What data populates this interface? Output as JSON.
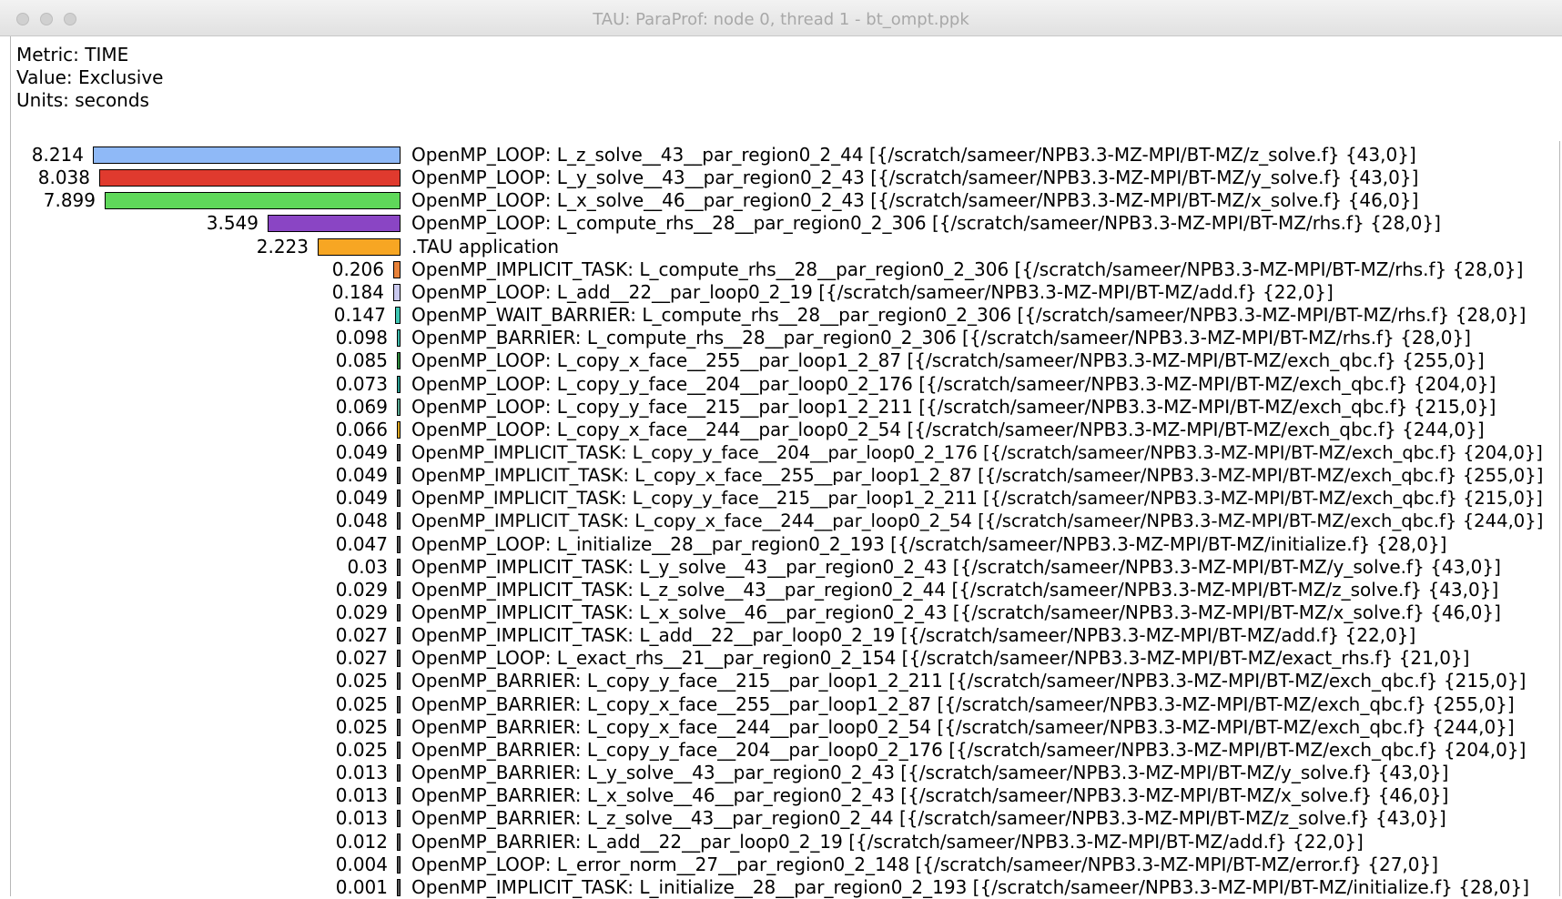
{
  "window": {
    "title": "TAU: ParaProf: node 0, thread 1 - bt_ompt.ppk"
  },
  "header": {
    "metric": "Metric: TIME",
    "value": "Value: Exclusive",
    "units": "Units: seconds"
  },
  "bar_max_value": 8.214,
  "rows": [
    {
      "value": "8.214",
      "color": "#8fb9f7",
      "name": "OpenMP_LOOP: L_z_solve__43__par_region0_2_44 [{/scratch/sameer/NPB3.3-MZ-MPI/BT-MZ/z_solve.f} {43,0}]"
    },
    {
      "value": "8.038",
      "color": "#e03a2e",
      "name": "OpenMP_LOOP: L_y_solve__43__par_region0_2_43 [{/scratch/sameer/NPB3.3-MZ-MPI/BT-MZ/y_solve.f} {43,0}]"
    },
    {
      "value": "7.899",
      "color": "#5fd85a",
      "name": "OpenMP_LOOP: L_x_solve__46__par_region0_2_43 [{/scratch/sameer/NPB3.3-MZ-MPI/BT-MZ/x_solve.f} {46,0}]"
    },
    {
      "value": "3.549",
      "color": "#8a45c4",
      "name": "OpenMP_LOOP: L_compute_rhs__28__par_region0_2_306 [{/scratch/sameer/NPB3.3-MZ-MPI/BT-MZ/rhs.f} {28,0}]"
    },
    {
      "value": "2.223",
      "color": "#f7a623",
      "name": ".TAU application"
    },
    {
      "value": "0.206",
      "color": "#e8823a",
      "name": "OpenMP_IMPLICIT_TASK: L_compute_rhs__28__par_region0_2_306 [{/scratch/sameer/NPB3.3-MZ-MPI/BT-MZ/rhs.f} {28,0}]"
    },
    {
      "value": "0.184",
      "color": "#c9c8ee",
      "name": "OpenMP_LOOP: L_add__22__par_loop0_2_19 [{/scratch/sameer/NPB3.3-MZ-MPI/BT-MZ/add.f} {22,0}]"
    },
    {
      "value": "0.147",
      "color": "#3fc7b3",
      "name": "OpenMP_WAIT_BARRIER: L_compute_rhs__28__par_region0_2_306 [{/scratch/sameer/NPB3.3-MZ-MPI/BT-MZ/rhs.f} {28,0}]"
    },
    {
      "value": "0.098",
      "color": "#3db8a8",
      "name": "OpenMP_BARRIER: L_compute_rhs__28__par_region0_2_306 [{/scratch/sameer/NPB3.3-MZ-MPI/BT-MZ/rhs.f} {28,0}]"
    },
    {
      "value": "0.085",
      "color": "#2e8b3d",
      "name": "OpenMP_LOOP: L_copy_x_face__255__par_loop1_2_87 [{/scratch/sameer/NPB3.3-MZ-MPI/BT-MZ/exch_qbc.f} {255,0}]"
    },
    {
      "value": "0.073",
      "color": "#2a9d8f",
      "name": "OpenMP_LOOP: L_copy_y_face__204__par_loop0_2_176 [{/scratch/sameer/NPB3.3-MZ-MPI/BT-MZ/exch_qbc.f} {204,0}]"
    },
    {
      "value": "0.069",
      "color": "#58a890",
      "name": "OpenMP_LOOP: L_copy_y_face__215__par_loop1_2_211 [{/scratch/sameer/NPB3.3-MZ-MPI/BT-MZ/exch_qbc.f} {215,0}]"
    },
    {
      "value": "0.066",
      "color": "#d9a420",
      "name": "OpenMP_LOOP: L_copy_x_face__244__par_loop0_2_54 [{/scratch/sameer/NPB3.3-MZ-MPI/BT-MZ/exch_qbc.f} {244,0}]"
    },
    {
      "value": "0.049",
      "color": "#555555",
      "name": "OpenMP_IMPLICIT_TASK: L_copy_y_face__204__par_loop0_2_176 [{/scratch/sameer/NPB3.3-MZ-MPI/BT-MZ/exch_qbc.f} {204,0}]"
    },
    {
      "value": "0.049",
      "color": "#555555",
      "name": "OpenMP_IMPLICIT_TASK: L_copy_x_face__255__par_loop1_2_87 [{/scratch/sameer/NPB3.3-MZ-MPI/BT-MZ/exch_qbc.f} {255,0}]"
    },
    {
      "value": "0.049",
      "color": "#555555",
      "name": "OpenMP_IMPLICIT_TASK: L_copy_y_face__215__par_loop1_2_211 [{/scratch/sameer/NPB3.3-MZ-MPI/BT-MZ/exch_qbc.f} {215,0}]"
    },
    {
      "value": "0.048",
      "color": "#555555",
      "name": "OpenMP_IMPLICIT_TASK: L_copy_x_face__244__par_loop0_2_54 [{/scratch/sameer/NPB3.3-MZ-MPI/BT-MZ/exch_qbc.f} {244,0}]"
    },
    {
      "value": "0.047",
      "color": "#555555",
      "name": "OpenMP_LOOP: L_initialize__28__par_region0_2_193 [{/scratch/sameer/NPB3.3-MZ-MPI/BT-MZ/initialize.f} {28,0}]"
    },
    {
      "value": "0.03",
      "color": "#555555",
      "name": "OpenMP_IMPLICIT_TASK: L_y_solve__43__par_region0_2_43 [{/scratch/sameer/NPB3.3-MZ-MPI/BT-MZ/y_solve.f} {43,0}]"
    },
    {
      "value": "0.029",
      "color": "#555555",
      "name": "OpenMP_IMPLICIT_TASK: L_z_solve__43__par_region0_2_44 [{/scratch/sameer/NPB3.3-MZ-MPI/BT-MZ/z_solve.f} {43,0}]"
    },
    {
      "value": "0.029",
      "color": "#555555",
      "name": "OpenMP_IMPLICIT_TASK: L_x_solve__46__par_region0_2_43 [{/scratch/sameer/NPB3.3-MZ-MPI/BT-MZ/x_solve.f} {46,0}]"
    },
    {
      "value": "0.027",
      "color": "#555555",
      "name": "OpenMP_IMPLICIT_TASK: L_add__22__par_loop0_2_19 [{/scratch/sameer/NPB3.3-MZ-MPI/BT-MZ/add.f} {22,0}]"
    },
    {
      "value": "0.027",
      "color": "#555555",
      "name": "OpenMP_LOOP: L_exact_rhs__21__par_region0_2_154 [{/scratch/sameer/NPB3.3-MZ-MPI/BT-MZ/exact_rhs.f} {21,0}]"
    },
    {
      "value": "0.025",
      "color": "#555555",
      "name": "OpenMP_BARRIER: L_copy_y_face__215__par_loop1_2_211 [{/scratch/sameer/NPB3.3-MZ-MPI/BT-MZ/exch_qbc.f} {215,0}]"
    },
    {
      "value": "0.025",
      "color": "#555555",
      "name": "OpenMP_BARRIER: L_copy_x_face__255__par_loop1_2_87 [{/scratch/sameer/NPB3.3-MZ-MPI/BT-MZ/exch_qbc.f} {255,0}]"
    },
    {
      "value": "0.025",
      "color": "#555555",
      "name": "OpenMP_BARRIER: L_copy_x_face__244__par_loop0_2_54 [{/scratch/sameer/NPB3.3-MZ-MPI/BT-MZ/exch_qbc.f} {244,0}]"
    },
    {
      "value": "0.025",
      "color": "#555555",
      "name": "OpenMP_BARRIER: L_copy_y_face__204__par_loop0_2_176 [{/scratch/sameer/NPB3.3-MZ-MPI/BT-MZ/exch_qbc.f} {204,0}]"
    },
    {
      "value": "0.013",
      "color": "#555555",
      "name": "OpenMP_BARRIER: L_y_solve__43__par_region0_2_43 [{/scratch/sameer/NPB3.3-MZ-MPI/BT-MZ/y_solve.f} {43,0}]"
    },
    {
      "value": "0.013",
      "color": "#555555",
      "name": "OpenMP_BARRIER: L_x_solve__46__par_region0_2_43 [{/scratch/sameer/NPB3.3-MZ-MPI/BT-MZ/x_solve.f} {46,0}]"
    },
    {
      "value": "0.013",
      "color": "#555555",
      "name": "OpenMP_BARRIER: L_z_solve__43__par_region0_2_44 [{/scratch/sameer/NPB3.3-MZ-MPI/BT-MZ/z_solve.f} {43,0}]"
    },
    {
      "value": "0.012",
      "color": "#555555",
      "name": "OpenMP_BARRIER: L_add__22__par_loop0_2_19 [{/scratch/sameer/NPB3.3-MZ-MPI/BT-MZ/add.f} {22,0}]"
    },
    {
      "value": "0.004",
      "color": "#555555",
      "name": "OpenMP_LOOP: L_error_norm__27__par_region0_2_148 [{/scratch/sameer/NPB3.3-MZ-MPI/BT-MZ/error.f} {27,0}]"
    },
    {
      "value": "0.001",
      "color": "#555555",
      "name": "OpenMP_IMPLICIT_TASK: L_initialize__28__par_region0_2_193 [{/scratch/sameer/NPB3.3-MZ-MPI/BT-MZ/initialize.f} {28,0}]"
    }
  ]
}
